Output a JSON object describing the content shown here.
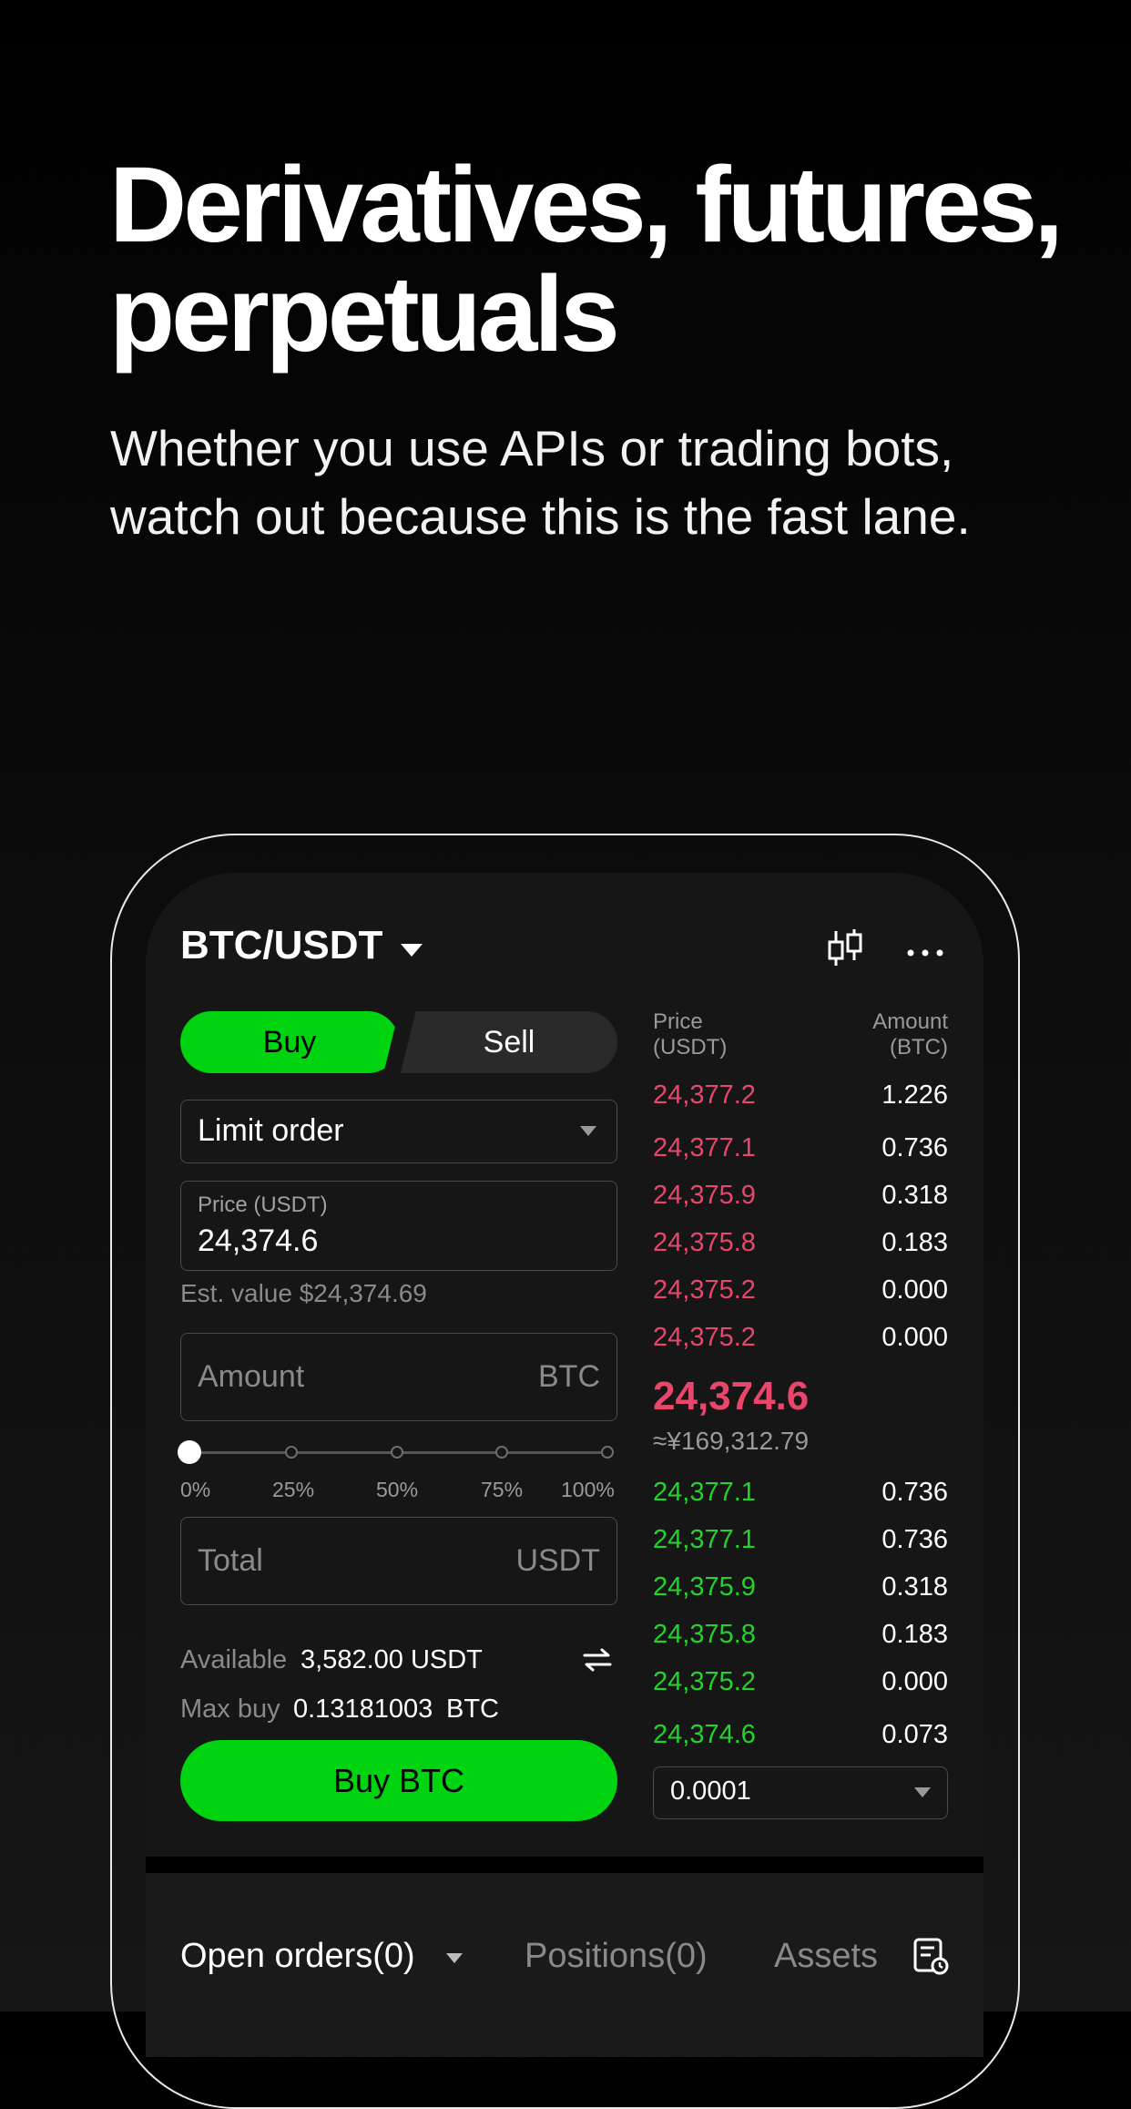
{
  "hero": {
    "title_line1": "Derivatives, futures,",
    "title_line2": "perpetuals",
    "subtitle_line1": "Whether you use APIs or trading bots,",
    "subtitle_line2": "watch out because this is the fast lane."
  },
  "header": {
    "pair": "BTC/USDT"
  },
  "trade": {
    "buy_label": "Buy",
    "sell_label": "Sell",
    "order_type": "Limit order",
    "price_label": "Price (USDT)",
    "price_value": "24,374.6",
    "est_value": "Est. value $24,374.69",
    "amount_placeholder": "Amount",
    "amount_unit": "BTC",
    "slider_labels": [
      "0%",
      "25%",
      "50%",
      "75%",
      "100%"
    ],
    "slider_value_percent": 0,
    "total_placeholder": "Total",
    "total_unit": "USDT",
    "available_label": "Available",
    "available_value": "3,582.00 USDT",
    "maxbuy_label": "Max buy",
    "maxbuy_value": "0.13181003",
    "maxbuy_unit": "BTC",
    "submit_label": "Buy BTC"
  },
  "orderbook": {
    "price_header_1": "Price",
    "price_header_2": "(USDT)",
    "amount_header_1": "Amount",
    "amount_header_2": "(BTC)",
    "asks": [
      {
        "price": "24,377.2",
        "amount": "1.226"
      },
      {
        "price": "24,377.1",
        "amount": "0.736"
      },
      {
        "price": "24,375.9",
        "amount": "0.318"
      },
      {
        "price": "24,375.8",
        "amount": "0.183"
      },
      {
        "price": "24,375.2",
        "amount": "0.000"
      },
      {
        "price": "24,375.2",
        "amount": "0.000"
      }
    ],
    "last_price": "24,374.6",
    "last_price_cny": "≈¥169,312.79",
    "bids": [
      {
        "price": "24,377.1",
        "amount": "0.736"
      },
      {
        "price": "24,377.1",
        "amount": "0.736"
      },
      {
        "price": "24,375.9",
        "amount": "0.318"
      },
      {
        "price": "24,375.8",
        "amount": "0.183"
      },
      {
        "price": "24,375.2",
        "amount": "0.000"
      },
      {
        "price": "24,374.6",
        "amount": "0.073"
      }
    ],
    "precision": "0.0001"
  },
  "bottom_tabs": {
    "open_orders": "Open orders(0)",
    "positions": "Positions(0)",
    "assets": "Assets"
  },
  "colors": {
    "accent_green": "#00d30f",
    "ask_red": "#e9466b",
    "bid_green": "#21d42b"
  }
}
